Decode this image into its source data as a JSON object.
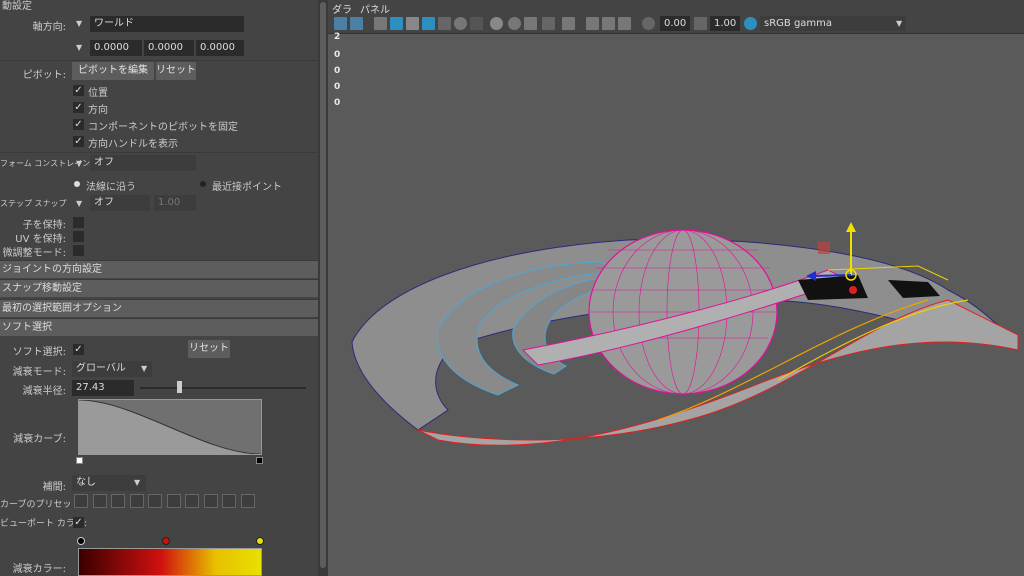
{
  "panel": {
    "top_header": "動設定",
    "axis_label": "軸方向:",
    "axis_value": "ワールド",
    "coord": [
      "0.0000",
      "0.0000",
      "0.0000"
    ],
    "pivot_label": "ピボット:",
    "pivot_edit_btn": "ピボットを編集",
    "pivot_reset_btn": "リセット",
    "pivot_checks": [
      "位置",
      "方向",
      "コンポーネントのピボットを固定",
      "方向ハンドルを表示"
    ],
    "transform_constraint_label": "フォーム コンストレイント:",
    "transform_constraint_value": "オフ",
    "radio_along_normal": "法線に沿う",
    "radio_nearest_point": "最近接ポイント",
    "step_snap_label": "ステップ スナップ",
    "step_snap_value": "オフ",
    "step_snap_number": "1.00",
    "keep_children": "子を保持:",
    "keep_uv": "UV を保持:",
    "tweak_mode": "微調整モード:",
    "section_joint": "ジョイントの方向設定",
    "section_snap": "スナップ移動設定",
    "section_select": "最初の選択範囲オプション",
    "section_soft": "ソフト選択",
    "soft_select_label": "ソフト選択:",
    "soft_reset_btn": "リセット",
    "falloff_mode_label": "減衰モード:",
    "falloff_mode_value": "グローバル",
    "falloff_radius_label": "減衰半径:",
    "falloff_radius_value": "27.43",
    "falloff_radius_fraction": 0.22,
    "falloff_curve_label": "減衰カーブ:",
    "interp_label": "補間:",
    "interp_value": "なし",
    "curve_presets_label": "カーブのプリセット:",
    "viewport_color_label": "ビューポート カラー:",
    "falloff_color_label": "減衰カラー:"
  },
  "viewport": {
    "menu": [
      "ダラ",
      "パネル"
    ],
    "exposure": "0.00",
    "gamma": "1.00",
    "colorspace": "sRGB gamma",
    "hud_values": [
      "2",
      "0",
      "0",
      "0",
      "0"
    ]
  },
  "colors": {
    "panel_bg": "#444444",
    "viewport_bg": "#5a5a5a",
    "section_bg": "#5d5d5d",
    "field_bg": "#2b2b2b",
    "falloff_gradient": [
      "#3a0000",
      "#d01010",
      "#e8c000",
      "#e8e000"
    ]
  }
}
